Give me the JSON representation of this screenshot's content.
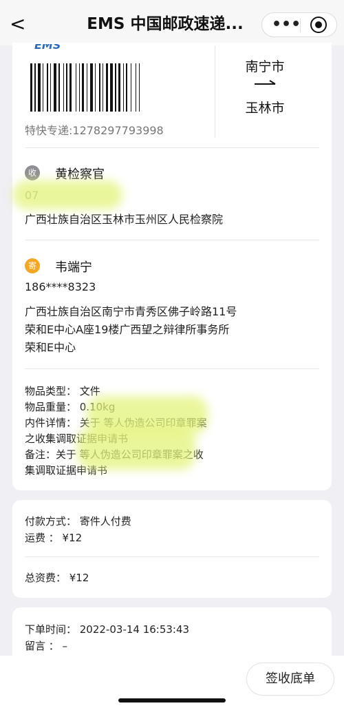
{
  "nav": {
    "back_glyph": "<",
    "title": "EMS 中国邮政速递...",
    "more_glyph": "•••"
  },
  "waybill": {
    "logo_text": "EMS",
    "tracking": "特快专递:1278297793998",
    "from_city": "南宁市",
    "to_city": "玉林市"
  },
  "receiver": {
    "badge": "收",
    "badge_color": "#8e8e93",
    "name": "黄检察官",
    "phone": "07",
    "address": "广西壮族自治区玉林市玉州区人民检察院"
  },
  "sender": {
    "badge": "寄",
    "badge_color": "#f5a623",
    "name": "韦端宁",
    "phone": "186****8323",
    "address_line1": "广西壮族自治区南宁市青秀区佛子岭路11号",
    "address_line2": "荣和E中心A座19楼广西望之辩律所事务所",
    "address_line3": "荣和E中心"
  },
  "item": {
    "type": "物品类型：  文件",
    "weight": "物品重量：  0.10kg",
    "detail_line1": "内件详情：  关于                                              等人伪造公司印章罪案",
    "detail_line2": "之收集调取证据申请书",
    "note_line1": "备注：关于                                                  等人伪造公司印章罪案之收",
    "note_line2": "集调取证据申请书"
  },
  "payment": {
    "method": "付款方式：  寄件人付费",
    "freight": "运费         ：  ¥12",
    "total": "总资费：  ¥12"
  },
  "order": {
    "time": "下单时间：  2022-03-14 16:53:43",
    "message": "留言         ：  –"
  },
  "actions": {
    "sign_receipt": "签收底单"
  }
}
